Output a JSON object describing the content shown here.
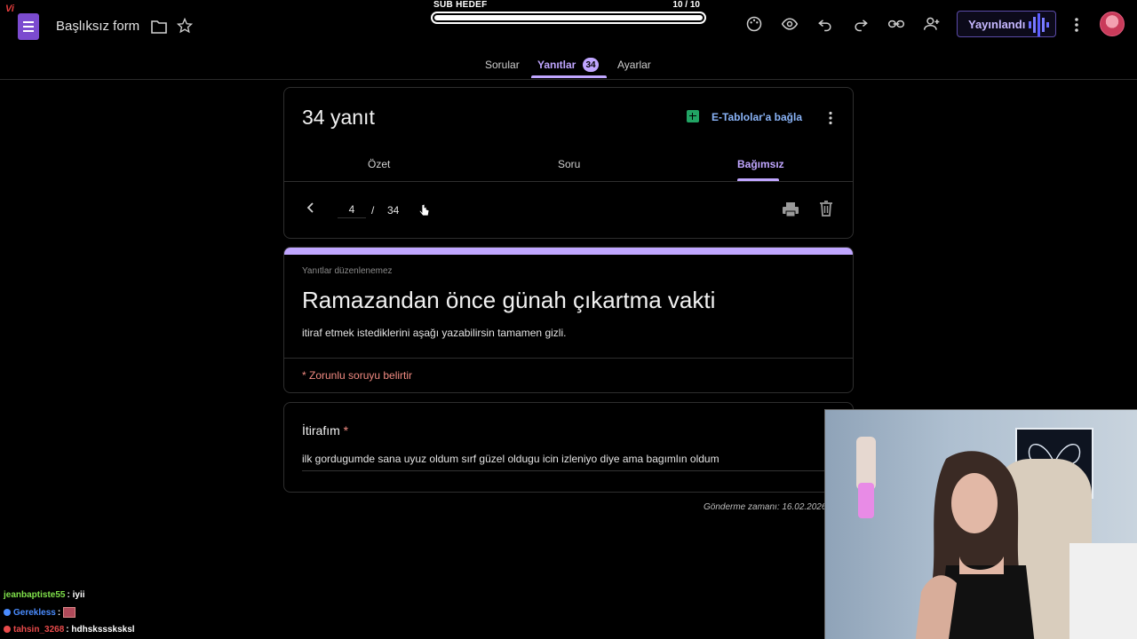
{
  "window": {
    "doc_title": "Başlıksız form",
    "corner_logo": "Vi",
    "publish_label": "Yayınlandı"
  },
  "subgoal": {
    "label": "SUB HEDEF",
    "count_text": "10 / 10",
    "progress": 1.0
  },
  "tabs": {
    "questions": "Sorular",
    "responses": "Yanıtlar",
    "responses_badge": "34",
    "settings": "Ayarlar",
    "active": "responses"
  },
  "summary": {
    "count_title": "34 yanıt",
    "sheets_link": "E-Tablolar'a bağla",
    "subtabs": [
      "Özet",
      "Soru",
      "Bağımsız"
    ],
    "active_subtab": "Bağımsız",
    "pager_current": "4",
    "pager_separator": "/",
    "pager_total": "34"
  },
  "form_header": {
    "no_edit_note": "Yanıtlar düzenlenemez",
    "title": "Ramazandan önce günah çıkartma vakti",
    "description": "itiraf etmek istediklerini aşağı yazabilirsin tamamen gizli.",
    "required_note": "* Zorunlu soruyu belirtir"
  },
  "question": {
    "label": "İtirafım",
    "required_marker": "*",
    "answer": "ilk gordugumde sana uyuz oldum sırf güzel oldugu icin izleniyo diye ama bagımlın oldum"
  },
  "timestamp": "Gönderme zamanı: 16.02.2026",
  "chat": [
    {
      "user": "jeanbaptiste55",
      "sep": ":",
      "msg": "iyii",
      "color": "#7fe04a"
    },
    {
      "user": "Gerekless",
      "sep": ":",
      "msg": "",
      "color": "#4a8cff",
      "emote": true
    },
    {
      "user": "tahsin_3268",
      "sep": ":",
      "msg": "hdhsksssksksl",
      "color": "#e84a4a"
    }
  ],
  "colors": {
    "accent": "#c0a6ff",
    "link": "#8ab4f8",
    "required": "#f28b82",
    "sheets": "#21a464"
  }
}
